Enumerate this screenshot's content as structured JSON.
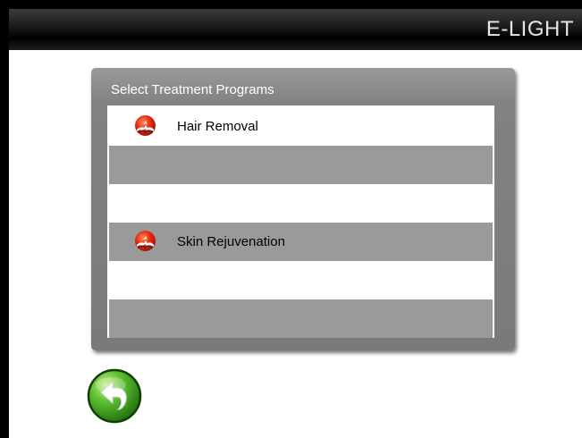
{
  "header": {
    "title": "E-LIGHT"
  },
  "panel": {
    "title": "Select Treatment Programs",
    "rows": [
      {
        "label": "Hair Removal",
        "has_icon": true,
        "shade": "white"
      },
      {
        "label": "",
        "has_icon": false,
        "shade": "grey"
      },
      {
        "label": "",
        "has_icon": false,
        "shade": "white"
      },
      {
        "label": "Skin Rejuvenation",
        "has_icon": true,
        "shade": "grey"
      },
      {
        "label": "",
        "has_icon": false,
        "shade": "white"
      },
      {
        "label": "",
        "has_icon": false,
        "shade": "grey"
      }
    ]
  },
  "icons": {
    "program": "program-sun-icon",
    "back": "back-arrow-icon"
  },
  "colors": {
    "header_text": "#e6e6e6",
    "panel": "#828282",
    "grey_row": "#9a9a9a",
    "white_row": "#ffffff",
    "icon_red": "#e8260f",
    "back_green": "#2f9a1a"
  }
}
